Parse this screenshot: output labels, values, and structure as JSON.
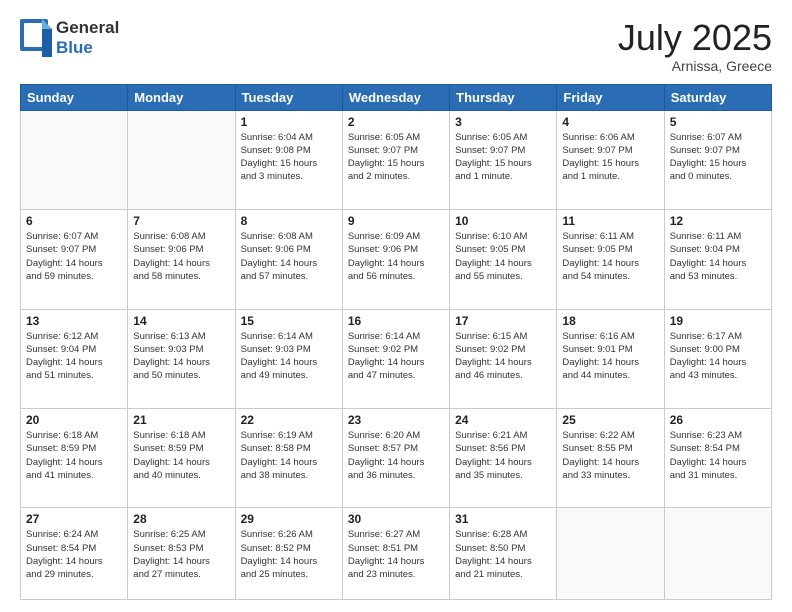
{
  "header": {
    "logo_general": "General",
    "logo_blue": "Blue",
    "title": "July 2025",
    "location": "Arnissa, Greece"
  },
  "weekdays": [
    "Sunday",
    "Monday",
    "Tuesday",
    "Wednesday",
    "Thursday",
    "Friday",
    "Saturday"
  ],
  "weeks": [
    [
      {
        "day": "",
        "content": ""
      },
      {
        "day": "",
        "content": ""
      },
      {
        "day": "1",
        "content": "Sunrise: 6:04 AM\nSunset: 9:08 PM\nDaylight: 15 hours\nand 3 minutes."
      },
      {
        "day": "2",
        "content": "Sunrise: 6:05 AM\nSunset: 9:07 PM\nDaylight: 15 hours\nand 2 minutes."
      },
      {
        "day": "3",
        "content": "Sunrise: 6:05 AM\nSunset: 9:07 PM\nDaylight: 15 hours\nand 1 minute."
      },
      {
        "day": "4",
        "content": "Sunrise: 6:06 AM\nSunset: 9:07 PM\nDaylight: 15 hours\nand 1 minute."
      },
      {
        "day": "5",
        "content": "Sunrise: 6:07 AM\nSunset: 9:07 PM\nDaylight: 15 hours\nand 0 minutes."
      }
    ],
    [
      {
        "day": "6",
        "content": "Sunrise: 6:07 AM\nSunset: 9:07 PM\nDaylight: 14 hours\nand 59 minutes."
      },
      {
        "day": "7",
        "content": "Sunrise: 6:08 AM\nSunset: 9:06 PM\nDaylight: 14 hours\nand 58 minutes."
      },
      {
        "day": "8",
        "content": "Sunrise: 6:08 AM\nSunset: 9:06 PM\nDaylight: 14 hours\nand 57 minutes."
      },
      {
        "day": "9",
        "content": "Sunrise: 6:09 AM\nSunset: 9:06 PM\nDaylight: 14 hours\nand 56 minutes."
      },
      {
        "day": "10",
        "content": "Sunrise: 6:10 AM\nSunset: 9:05 PM\nDaylight: 14 hours\nand 55 minutes."
      },
      {
        "day": "11",
        "content": "Sunrise: 6:11 AM\nSunset: 9:05 PM\nDaylight: 14 hours\nand 54 minutes."
      },
      {
        "day": "12",
        "content": "Sunrise: 6:11 AM\nSunset: 9:04 PM\nDaylight: 14 hours\nand 53 minutes."
      }
    ],
    [
      {
        "day": "13",
        "content": "Sunrise: 6:12 AM\nSunset: 9:04 PM\nDaylight: 14 hours\nand 51 minutes."
      },
      {
        "day": "14",
        "content": "Sunrise: 6:13 AM\nSunset: 9:03 PM\nDaylight: 14 hours\nand 50 minutes."
      },
      {
        "day": "15",
        "content": "Sunrise: 6:14 AM\nSunset: 9:03 PM\nDaylight: 14 hours\nand 49 minutes."
      },
      {
        "day": "16",
        "content": "Sunrise: 6:14 AM\nSunset: 9:02 PM\nDaylight: 14 hours\nand 47 minutes."
      },
      {
        "day": "17",
        "content": "Sunrise: 6:15 AM\nSunset: 9:02 PM\nDaylight: 14 hours\nand 46 minutes."
      },
      {
        "day": "18",
        "content": "Sunrise: 6:16 AM\nSunset: 9:01 PM\nDaylight: 14 hours\nand 44 minutes."
      },
      {
        "day": "19",
        "content": "Sunrise: 6:17 AM\nSunset: 9:00 PM\nDaylight: 14 hours\nand 43 minutes."
      }
    ],
    [
      {
        "day": "20",
        "content": "Sunrise: 6:18 AM\nSunset: 8:59 PM\nDaylight: 14 hours\nand 41 minutes."
      },
      {
        "day": "21",
        "content": "Sunrise: 6:18 AM\nSunset: 8:59 PM\nDaylight: 14 hours\nand 40 minutes."
      },
      {
        "day": "22",
        "content": "Sunrise: 6:19 AM\nSunset: 8:58 PM\nDaylight: 14 hours\nand 38 minutes."
      },
      {
        "day": "23",
        "content": "Sunrise: 6:20 AM\nSunset: 8:57 PM\nDaylight: 14 hours\nand 36 minutes."
      },
      {
        "day": "24",
        "content": "Sunrise: 6:21 AM\nSunset: 8:56 PM\nDaylight: 14 hours\nand 35 minutes."
      },
      {
        "day": "25",
        "content": "Sunrise: 6:22 AM\nSunset: 8:55 PM\nDaylight: 14 hours\nand 33 minutes."
      },
      {
        "day": "26",
        "content": "Sunrise: 6:23 AM\nSunset: 8:54 PM\nDaylight: 14 hours\nand 31 minutes."
      }
    ],
    [
      {
        "day": "27",
        "content": "Sunrise: 6:24 AM\nSunset: 8:54 PM\nDaylight: 14 hours\nand 29 minutes."
      },
      {
        "day": "28",
        "content": "Sunrise: 6:25 AM\nSunset: 8:53 PM\nDaylight: 14 hours\nand 27 minutes."
      },
      {
        "day": "29",
        "content": "Sunrise: 6:26 AM\nSunset: 8:52 PM\nDaylight: 14 hours\nand 25 minutes."
      },
      {
        "day": "30",
        "content": "Sunrise: 6:27 AM\nSunset: 8:51 PM\nDaylight: 14 hours\nand 23 minutes."
      },
      {
        "day": "31",
        "content": "Sunrise: 6:28 AM\nSunset: 8:50 PM\nDaylight: 14 hours\nand 21 minutes."
      },
      {
        "day": "",
        "content": ""
      },
      {
        "day": "",
        "content": ""
      }
    ]
  ]
}
